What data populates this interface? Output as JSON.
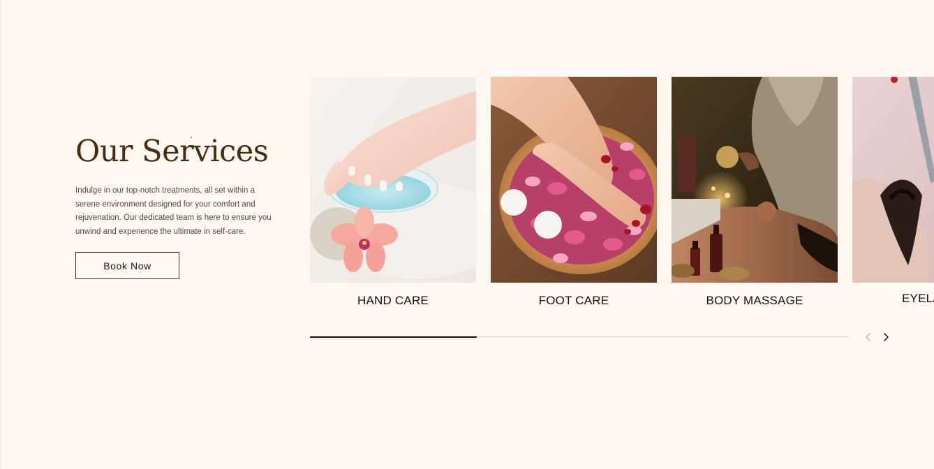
{
  "section": {
    "title": "Our Services",
    "description": "Indulge in our top-notch treatments, all set within a serene environment designed for your comfort and rejuvenation. Our dedicated team is here to ensure you unwind and experience the ultimate in self-care.",
    "cta_label": "Book Now"
  },
  "services": [
    {
      "label": "HAND CARE",
      "image": "hands-in-water-bowl-with-orchid"
    },
    {
      "label": "FOOT CARE",
      "image": "feet-in-rose-petal-bowl"
    },
    {
      "label": "BODY MASSAGE",
      "image": "back-massage-with-oils-and-candles"
    },
    {
      "label": "EYELA",
      "image": "eyelash-extension-closeup"
    }
  ],
  "carousel": {
    "progress": 0.31,
    "prev_icon": "chevron-left-icon",
    "next_icon": "chevron-right-icon",
    "prev_enabled": false,
    "next_enabled": true
  },
  "colors": {
    "background": "#fef7f2",
    "title": "#4a2b0e",
    "text": "#4d4a48",
    "accent_dot": "#c3302b",
    "progress_fill": "#111111",
    "progress_track": "#d7cecb"
  }
}
